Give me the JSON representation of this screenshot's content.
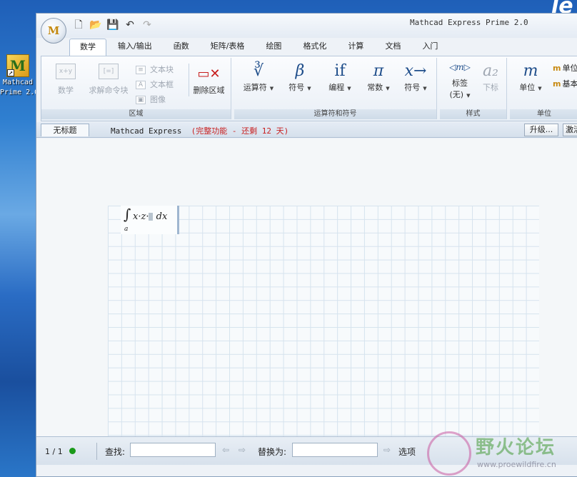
{
  "desktop": {
    "logo_fragment": "le",
    "icon_label_line1": "Mathcad",
    "icon_label_line2": "Prime 2.0",
    "icon_glyph": "M"
  },
  "window": {
    "title": "Mathcad Express Prime 2.0",
    "app_button": "M"
  },
  "quick_access": [
    "new-icon",
    "open-icon",
    "save-icon",
    "undo-icon",
    "redo-icon"
  ],
  "tabs": [
    {
      "label": "数学",
      "active": true
    },
    {
      "label": "输入/输出",
      "active": false
    },
    {
      "label": "函数",
      "active": false
    },
    {
      "label": "矩阵/表格",
      "active": false
    },
    {
      "label": "绘图",
      "active": false
    },
    {
      "label": "格式化",
      "active": false
    },
    {
      "label": "计算",
      "active": false
    },
    {
      "label": "文档",
      "active": false
    },
    {
      "label": "入门",
      "active": false
    }
  ],
  "ribbon": {
    "region_group": {
      "title": "区域",
      "math": "数学",
      "math_icon": "x+y",
      "solve_block": "求解命令块",
      "solve_icon": "[=]",
      "text_block": "文本块",
      "text_box": "文本框",
      "image": "图像",
      "delete_region": "删除区域"
    },
    "operators_group": {
      "title": "运算符和符号",
      "operators": "运算符",
      "operators_glyph": "∛",
      "symbols": "符号",
      "symbols_glyph": "β",
      "programming": "编程",
      "programming_glyph": "if",
      "constants": "常数",
      "constants_glyph": "π",
      "symbolics": "符号",
      "symbolics_glyph": "x→"
    },
    "style_group": {
      "title": "样式",
      "label": "标签",
      "label_value": "(无)",
      "subscript": "下标",
      "subscript_glyph": "a₂"
    },
    "units_group": {
      "title": "单位",
      "units": "单位",
      "units_glyph": "m",
      "unit_item1": "单位",
      "unit_item2": "基本"
    }
  },
  "docbar": {
    "tab_name": "无标题",
    "product": "Mathcad Express",
    "trial": "(完整功能 - 还剩 12 天)",
    "upgrade": "升级...",
    "activate": "激活"
  },
  "worksheet": {
    "integral_symbol": "∫",
    "lower_limit": "a",
    "expr_part1": "x",
    "dot": "·",
    "expr_part2": "z",
    "dx": "dx"
  },
  "statusbar": {
    "page": "1 / 1",
    "find_label": "查找:",
    "find_value": "",
    "replace_label": "替换为:",
    "replace_value": "",
    "options": "选项"
  },
  "watermark": {
    "text": "野火论坛",
    "url": "www.proewildfire.cn"
  }
}
